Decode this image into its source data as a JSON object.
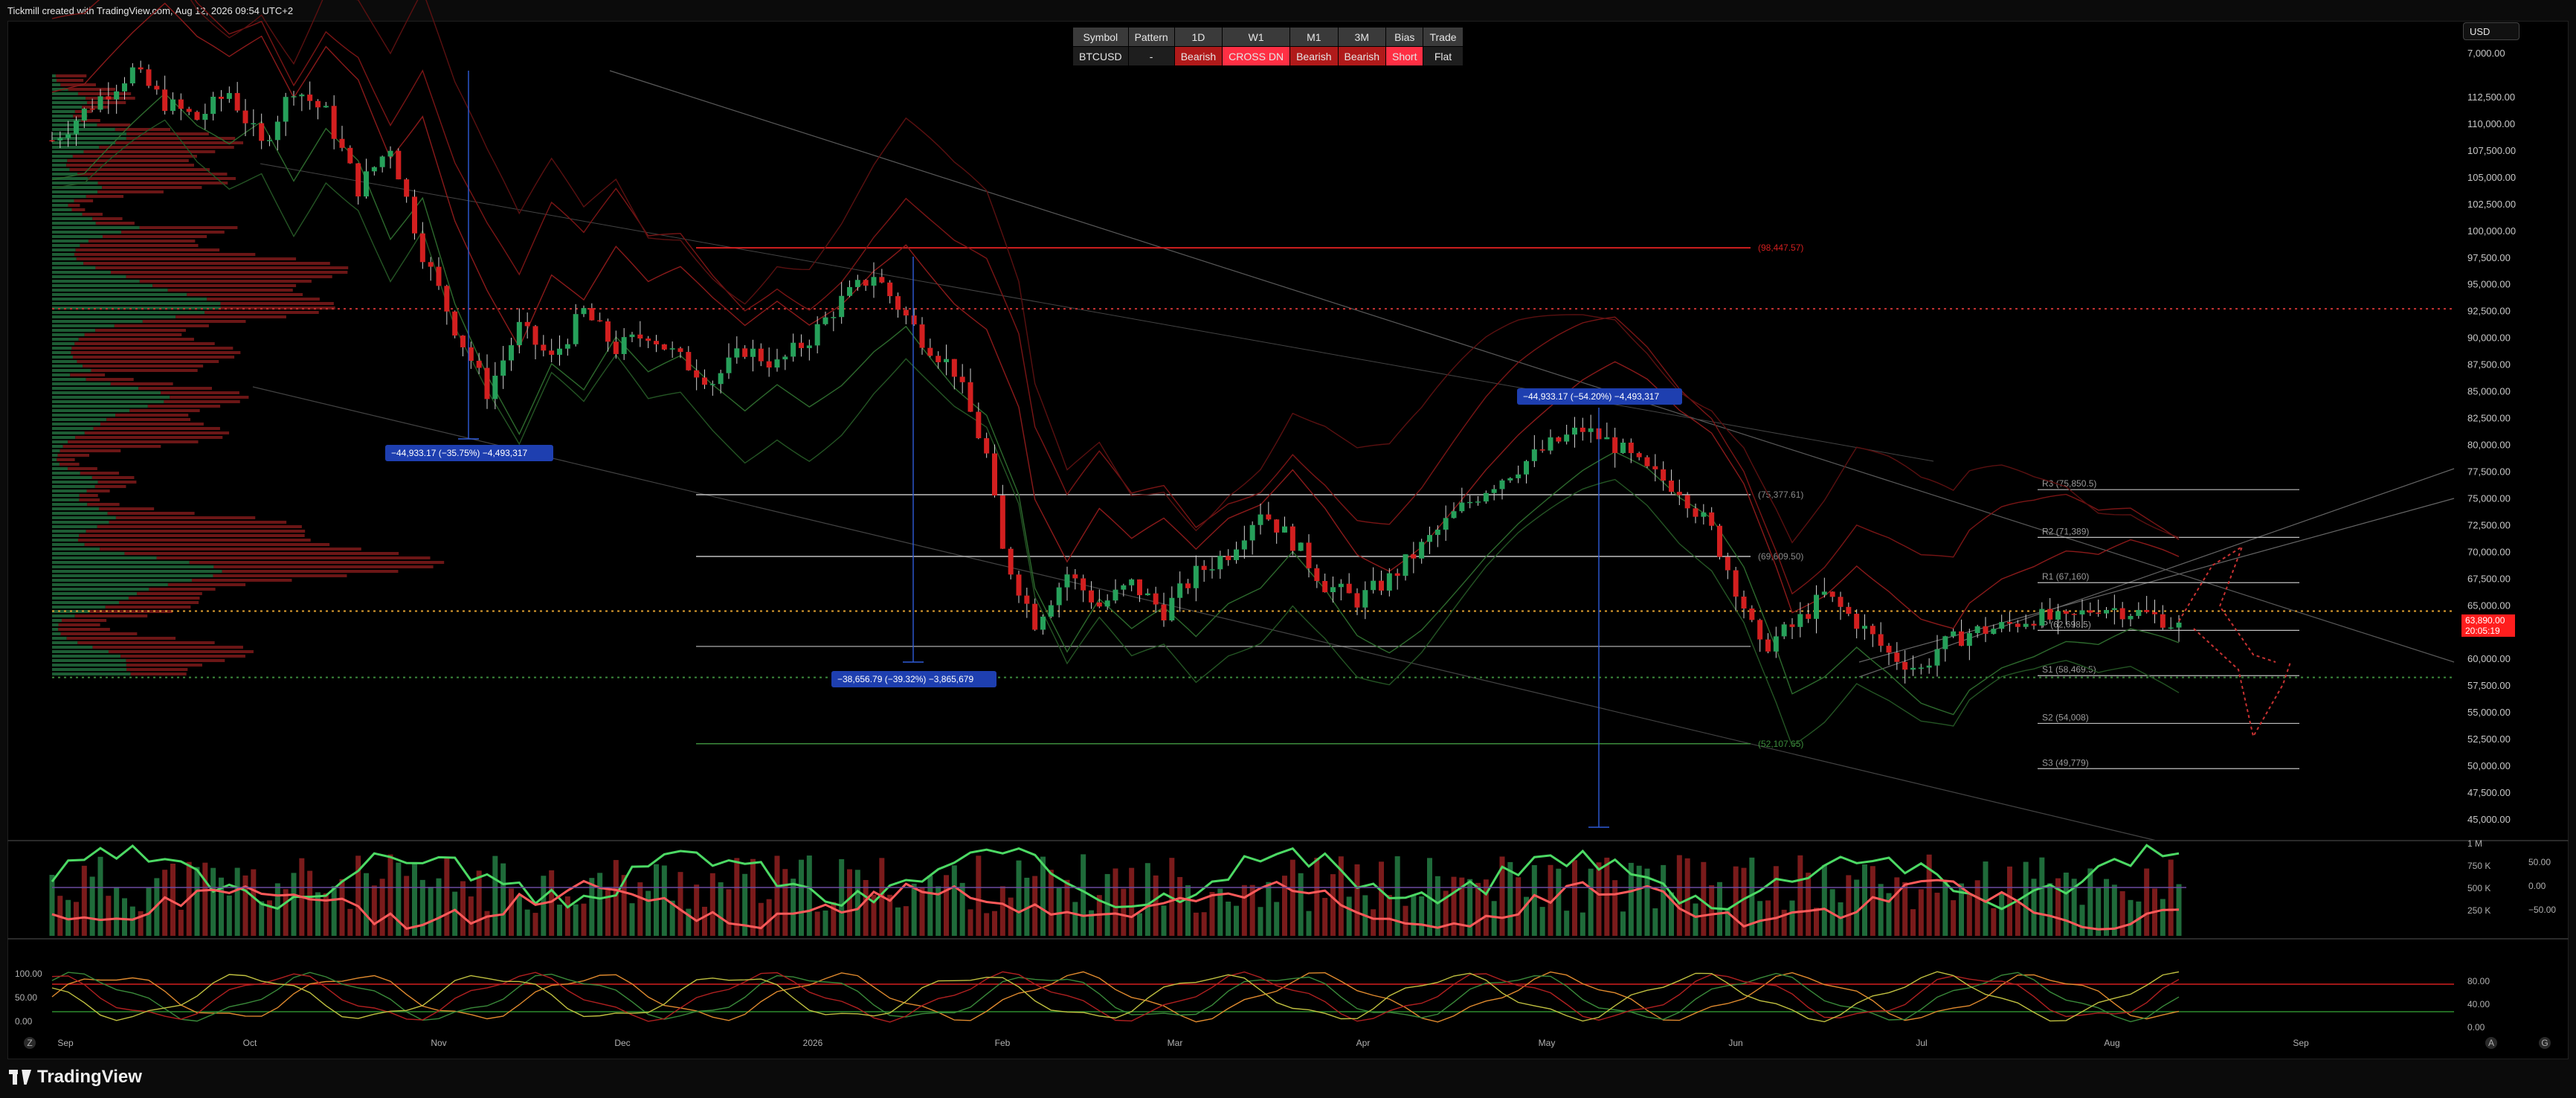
{
  "app": {
    "credit": "Tickmill created with TradingView.com, Aug 12, 2026 09:54 UTC+2",
    "brand": "TradingView",
    "currency": "USD",
    "corner_left": "Z",
    "corner_right_a": "A",
    "corner_right_b": "G"
  },
  "status_table": {
    "headers": [
      "Symbol",
      "Pattern",
      "1D",
      "W1",
      "M1",
      "3M",
      "Bias",
      "Trade"
    ],
    "values": [
      "BTCUSD",
      "-",
      "Bearish",
      "CROSS DN",
      "Bearish",
      "Bearish",
      "Short",
      "Flat"
    ],
    "styles": [
      "",
      "",
      "red",
      "brightred",
      "red",
      "red",
      "brightred",
      ""
    ]
  },
  "colors": {
    "bull": "#26a05a",
    "bear": "#d21f1f",
    "blue_box": "#1e3fb0",
    "price_tag": "#ff1e1e",
    "pivot_line": "#bfbfbf",
    "dotted_red": "#c83232",
    "dotted_yellow": "#e0a030",
    "dotted_green": "#3c8c3c"
  },
  "chart_data": {
    "type": "candlestick",
    "symbol": "BTCUSD",
    "ylim": [
      44000,
      116000
    ],
    "y_ticks": [
      "7,000.00",
      "112,500.00",
      "110,000.00",
      "107,500.00",
      "105,000.00",
      "102,500.00",
      "100,000.00",
      "97,500.00",
      "95,000.00",
      "92,500.00",
      "90,000.00",
      "87,500.00",
      "85,000.00",
      "82,500.00",
      "80,000.00",
      "77,500.00",
      "75,000.00",
      "72,500.00",
      "70,000.00",
      "67,500.00",
      "65,000.00",
      "62,500.00",
      "60,000.00",
      "57,500.00",
      "55,000.00",
      "52,500.00",
      "50,000.00",
      "47,500.00",
      "45,000.00"
    ],
    "x_labels": [
      "Sep",
      "Oct",
      "Nov",
      "Dec",
      "2026",
      "Feb",
      "Mar",
      "Apr",
      "May",
      "Jun",
      "Jul",
      "Aug",
      "Sep"
    ],
    "price_path": [
      [
        0,
        108500
      ],
      [
        3,
        112500
      ],
      [
        5,
        115000
      ],
      [
        7,
        112000
      ],
      [
        9,
        110500
      ],
      [
        11,
        113000
      ],
      [
        13,
        108000
      ],
      [
        15,
        113500
      ],
      [
        17,
        111000
      ],
      [
        19,
        104000
      ],
      [
        21,
        108000
      ],
      [
        23,
        98000
      ],
      [
        25,
        91000
      ],
      [
        27,
        85000
      ],
      [
        29,
        91000
      ],
      [
        31,
        88000
      ],
      [
        33,
        92500
      ],
      [
        35,
        89000
      ],
      [
        37,
        90500
      ],
      [
        39,
        88000
      ],
      [
        41,
        86000
      ],
      [
        43,
        89000
      ],
      [
        45,
        87500
      ],
      [
        47,
        90000
      ],
      [
        49,
        93500
      ],
      [
        51,
        96000
      ],
      [
        52,
        94000
      ],
      [
        54,
        90000
      ],
      [
        56,
        87000
      ],
      [
        58,
        79000
      ],
      [
        59,
        70000
      ],
      [
        61,
        63500
      ],
      [
        63,
        68000
      ],
      [
        65,
        65000
      ],
      [
        67,
        67000
      ],
      [
        69,
        64500
      ],
      [
        71,
        68000
      ],
      [
        73,
        70000
      ],
      [
        75,
        74000
      ],
      [
        77,
        71000
      ],
      [
        79,
        67000
      ],
      [
        81,
        65500
      ],
      [
        83,
        67500
      ],
      [
        85,
        70500
      ],
      [
        87,
        73500
      ],
      [
        89,
        76000
      ],
      [
        91,
        78000
      ],
      [
        93,
        80000
      ],
      [
        95,
        81500
      ],
      [
        97,
        80000
      ],
      [
        99,
        77500
      ],
      [
        101,
        76000
      ],
      [
        103,
        72000
      ],
      [
        105,
        65000
      ],
      [
        106,
        61000
      ],
      [
        108,
        63000
      ],
      [
        110,
        66000
      ],
      [
        112,
        63500
      ],
      [
        114,
        60500
      ],
      [
        116,
        59000
      ],
      [
        117,
        61000
      ],
      [
        119,
        62500
      ],
      [
        121,
        63000
      ],
      [
        123,
        64000
      ],
      [
        125,
        63500
      ],
      [
        127,
        65000
      ],
      [
        129,
        64500
      ],
      [
        131,
        63800
      ],
      [
        132,
        63000
      ]
    ],
    "horizontal_levels": [
      {
        "label": "(98,447.57)",
        "value": 98447.57,
        "color": "#d21f1f"
      },
      {
        "label": "(75,377.61)",
        "value": 75377.61,
        "color": "#bfbfbf"
      },
      {
        "label": "(69,609.50)",
        "value": 69609.5,
        "color": "#bfbfbf"
      },
      {
        "label": "(52,107.65)",
        "value": 52107.65,
        "color": "#3c8c3c"
      }
    ],
    "pivots": [
      {
        "label": "R3 (75,850.5)",
        "value": 75850.5
      },
      {
        "label": "R2 (71,389)",
        "value": 71389
      },
      {
        "label": "R1 (67,160)",
        "value": 67160
      },
      {
        "label": "P (62,698.5)",
        "value": 62698.5
      },
      {
        "label": "S1 (58,469.5)",
        "value": 58469.5
      },
      {
        "label": "S2 (54,008)",
        "value": 54008
      },
      {
        "label": "S3 (49,779)",
        "value": 49779
      }
    ],
    "measurements": [
      {
        "label": "−44,933.17 (−35.75%) −4,493,317"
      },
      {
        "label": "−38,656.79 (−39.32%) −3,865,679"
      },
      {
        "label": "−44,933.17 (−54.20%) −4,493,317"
      }
    ],
    "last_price": "63,890.00",
    "countdown": "20:05:19",
    "dotted_levels": [
      92750,
      64500,
      58300
    ],
    "volume_axis": [
      "1 M",
      "750 K",
      "500 K",
      "250 K"
    ],
    "volume_osc_axis": [
      "50.00",
      "0.00",
      "−50.00"
    ],
    "stoch_axis_left": [
      "100.00",
      "50.00",
      "0.00"
    ],
    "stoch_axis_right": [
      "80.00",
      "40.00",
      "0.00"
    ]
  }
}
